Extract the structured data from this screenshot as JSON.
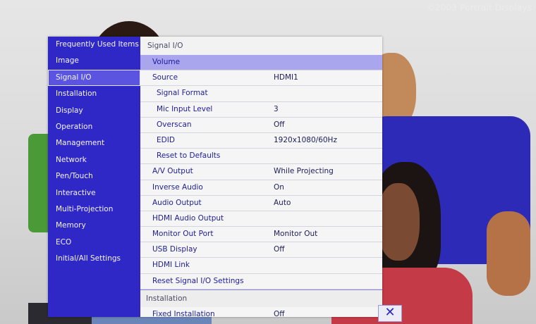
{
  "watermark": "©2003 Portrait Displays",
  "sidebar": {
    "items": [
      {
        "label": "Frequently Used Items"
      },
      {
        "label": "Image"
      },
      {
        "label": "Signal I/O"
      },
      {
        "label": "Installation"
      },
      {
        "label": "Display"
      },
      {
        "label": "Operation"
      },
      {
        "label": "Management"
      },
      {
        "label": "Network"
      },
      {
        "label": "Pen/Touch"
      },
      {
        "label": "Interactive"
      },
      {
        "label": "Multi-Projection"
      },
      {
        "label": "Memory"
      },
      {
        "label": "ECO"
      },
      {
        "label": "Initial/All Settings"
      }
    ],
    "selected": "Signal I/O"
  },
  "content": {
    "section_title": "Signal I/O",
    "rows": [
      {
        "label": "Volume",
        "value": ""
      },
      {
        "label": "Source",
        "value": "HDMI1"
      },
      {
        "label": "Signal Format",
        "value": ""
      },
      {
        "label": "Mic Input Level",
        "value": "3"
      },
      {
        "label": "Overscan",
        "value": "Off"
      },
      {
        "label": "EDID",
        "value": "1920x1080/60Hz"
      },
      {
        "label": "Reset to Defaults",
        "value": ""
      },
      {
        "label": "A/V Output",
        "value": "While Projecting"
      },
      {
        "label": "Inverse Audio",
        "value": "On"
      },
      {
        "label": "Audio Output",
        "value": "Auto"
      },
      {
        "label": "HDMI Audio Output",
        "value": ""
      },
      {
        "label": "Monitor Out Port",
        "value": "Monitor Out"
      },
      {
        "label": "USB Display",
        "value": "Off"
      },
      {
        "label": "HDMI Link",
        "value": ""
      },
      {
        "label": "Reset Signal I/O Settings",
        "value": ""
      }
    ],
    "next_section_title": "Installation",
    "next_rows": [
      {
        "label": "Fixed Installation",
        "value": "Off"
      }
    ]
  },
  "close_button": {
    "glyph": "✕"
  }
}
